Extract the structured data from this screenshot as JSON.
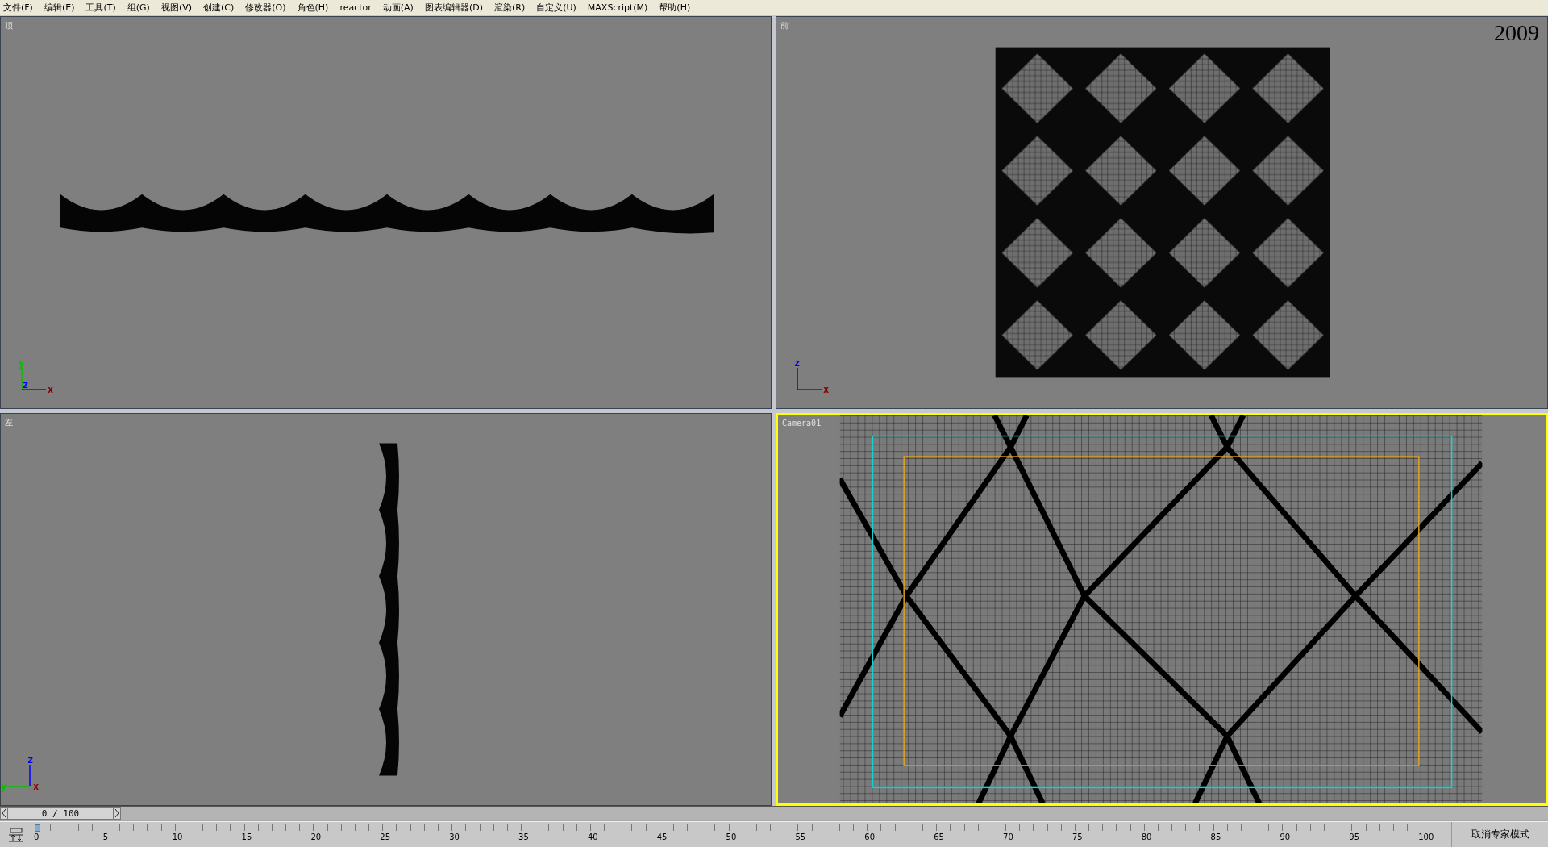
{
  "menu_bar": [
    "文件(F)",
    "编辑(E)",
    "工具(T)",
    "组(G)",
    "视图(V)",
    "创建(C)",
    "修改器(O)",
    "角色(H)",
    "reactor",
    "动画(A)",
    "图表编辑器(D)",
    "渲染(R)",
    "自定义(U)",
    "MAXScript(M)",
    "帮助(H)"
  ],
  "viewports": [
    {
      "label": "顶",
      "kind": "top",
      "active": false,
      "axes": [
        {
          "label": "y",
          "kind": "up",
          "color": "#00c000"
        },
        {
          "label": "z",
          "kind": "origin",
          "color": "#0000ff"
        },
        {
          "label": "x",
          "kind": "right",
          "color": "#8a0000"
        }
      ]
    },
    {
      "label": "前",
      "kind": "front",
      "active": false,
      "overlay_text": "2009",
      "axes": [
        {
          "label": "z",
          "kind": "up",
          "color": "#0000ff"
        },
        {
          "label": "x",
          "kind": "right",
          "color": "#8a0000"
        }
      ]
    },
    {
      "label": "左",
      "kind": "left",
      "active": false,
      "axes": [
        {
          "label": "z",
          "kind": "up",
          "color": "#0000ff"
        },
        {
          "label": "y",
          "kind": "left",
          "color": "#00c000"
        },
        {
          "label": "x",
          "kind": "origin",
          "color": "#8a0000"
        }
      ]
    },
    {
      "label": "Camera01",
      "kind": "camera",
      "active": true
    }
  ],
  "time_slider": {
    "text": "0 / 100"
  },
  "ruler": {
    "labels": [
      "0",
      "5",
      "10",
      "15",
      "20",
      "25",
      "30",
      "35",
      "40",
      "45",
      "50",
      "55",
      "60",
      "65",
      "70",
      "75",
      "80",
      "85",
      "90",
      "95",
      "100"
    ]
  },
  "expert_mode_button": "取消专家模式"
}
